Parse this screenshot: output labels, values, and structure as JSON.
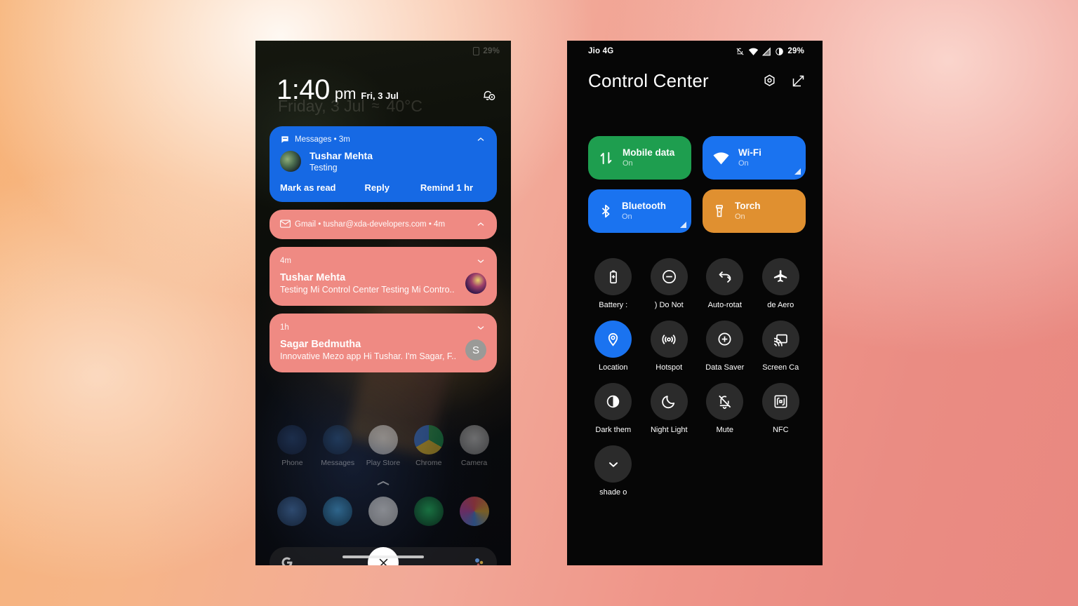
{
  "background": {
    "accent_orange": "#f7b378",
    "accent_salmon": "#ea8c83"
  },
  "left_phone": {
    "status": {
      "battery_pct": "29%"
    },
    "lock": {
      "time": "1:40",
      "ampm": "pm",
      "date": "Fri, 3 Jul",
      "ghost_date": "Friday, 3 Jul",
      "ghost_temp": "40°C",
      "bell_icon": "notification-settings-icon"
    },
    "notifications": [
      {
        "id": "messages",
        "color": "#1669e4",
        "app": "Messages",
        "app_icon": "messages-icon",
        "time": "3m",
        "header": "Messages • 3m",
        "title": "Tushar Mehta",
        "subtitle": "Testing",
        "chevron": "chevron-up-icon",
        "actions": [
          "Mark as read",
          "Reply",
          "Remind 1 hr"
        ]
      },
      {
        "id": "gmail",
        "color": "#ef8a83",
        "app": "Gmail",
        "app_icon": "gmail-icon",
        "time": "4m",
        "header": "Gmail • tushar@xda-developers.com • 4m",
        "chevron": "chevron-up-icon"
      },
      {
        "id": "tushar",
        "color": "#ef8a83",
        "header": "4m",
        "title": "Tushar Mehta",
        "subtitle": "Testing Mi Control Center Testing Mi Contro..",
        "chevron": "chevron-down-icon",
        "avatar": "art"
      },
      {
        "id": "sagar",
        "color": "#ef8a83",
        "header": "1h",
        "title": "Sagar Bedmutha",
        "subtitle": "Innovative Mezo app Hi Tushar. I'm Sagar, F..",
        "chevron": "chevron-down-icon",
        "avatar": "S"
      }
    ],
    "apps": [
      {
        "label": "Phone",
        "icon": "phone-icon"
      },
      {
        "label": "Messages",
        "icon": "messages-icon"
      },
      {
        "label": "Play Store",
        "icon": "play-store-icon"
      },
      {
        "label": "Chrome",
        "icon": "chrome-icon"
      },
      {
        "label": "Camera",
        "icon": "camera-icon"
      }
    ],
    "dock": [
      {
        "name": "trello",
        "icon": "trello-icon"
      },
      {
        "name": "twitter",
        "icon": "twitter-icon"
      },
      {
        "name": "slack",
        "icon": "slack-icon"
      },
      {
        "name": "spotify",
        "icon": "spotify-icon"
      },
      {
        "name": "one",
        "icon": "one-icon"
      }
    ],
    "search": {
      "left_icon": "google-g-icon",
      "right_icon": "google-assistant-icon"
    },
    "clear_all_icon": "close-icon"
  },
  "right_phone": {
    "status": {
      "carrier": "Jio 4G",
      "battery_pct": "29%",
      "icons": [
        "mute-icon",
        "wifi-icon",
        "signal-icon",
        "battery-icon"
      ]
    },
    "header": {
      "title": "Control Center",
      "settings_icon": "gear-icon",
      "edit_icon": "edit-icon"
    },
    "big_tiles": [
      {
        "name": "Mobile data",
        "state": "On",
        "color": "#1e9e4f",
        "icon": "mobile-data-icon",
        "expandable": false
      },
      {
        "name": "Wi-Fi",
        "state": "On",
        "color": "#1a73f0",
        "icon": "wifi-icon",
        "expandable": true
      },
      {
        "name": "Bluetooth",
        "state": "On",
        "color": "#1a73f0",
        "icon": "bluetooth-icon",
        "expandable": true
      },
      {
        "name": "Torch",
        "state": "On",
        "color": "#e09030",
        "icon": "torch-icon",
        "expandable": false
      }
    ],
    "small_tiles": [
      {
        "label": "Battery :",
        "icon": "battery-saver-icon",
        "on": false
      },
      {
        "label": ")   Do Not",
        "icon": "do-not-disturb-icon",
        "on": false
      },
      {
        "label": "Auto-rotat",
        "icon": "auto-rotate-icon",
        "on": false
      },
      {
        "label": "de    Aero",
        "icon": "airplane-icon",
        "on": false
      },
      {
        "label": "Location",
        "icon": "location-icon",
        "on": true
      },
      {
        "label": "Hotspot",
        "icon": "hotspot-icon",
        "on": false
      },
      {
        "label": "Data Saver",
        "icon": "data-saver-icon",
        "on": false
      },
      {
        "label": "Screen Ca",
        "icon": "screen-cast-icon",
        "on": false
      },
      {
        "label": "Dark them",
        "icon": "dark-theme-icon",
        "on": false
      },
      {
        "label": "Night Light",
        "icon": "night-light-icon",
        "on": false
      },
      {
        "label": "Mute",
        "icon": "mute-icon",
        "on": false
      },
      {
        "label": "NFC",
        "icon": "nfc-icon",
        "on": false
      },
      {
        "label": "shade     o",
        "icon": "chevron-down-icon",
        "on": false
      }
    ]
  }
}
